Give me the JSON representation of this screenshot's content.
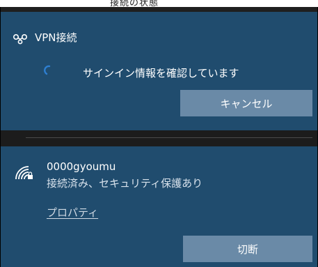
{
  "top_cut_text": "接続の状態",
  "vpn": {
    "icon": "vpn-link-icon",
    "title": "VPN接続",
    "status": "サインイン情報を確認しています",
    "cancel_label": "キャンセル"
  },
  "wifi": {
    "icon": "wifi-secured-icon",
    "network_name": "0000gyoumu",
    "status": "接続済み、セキュリティ保護あり",
    "properties_label": "プロパティ",
    "disconnect_label": "切断"
  },
  "colors": {
    "panel": "#204c6e",
    "button": "#6a8aa7",
    "background": "#1f1f1f",
    "spinner": "#2e7fd1"
  }
}
